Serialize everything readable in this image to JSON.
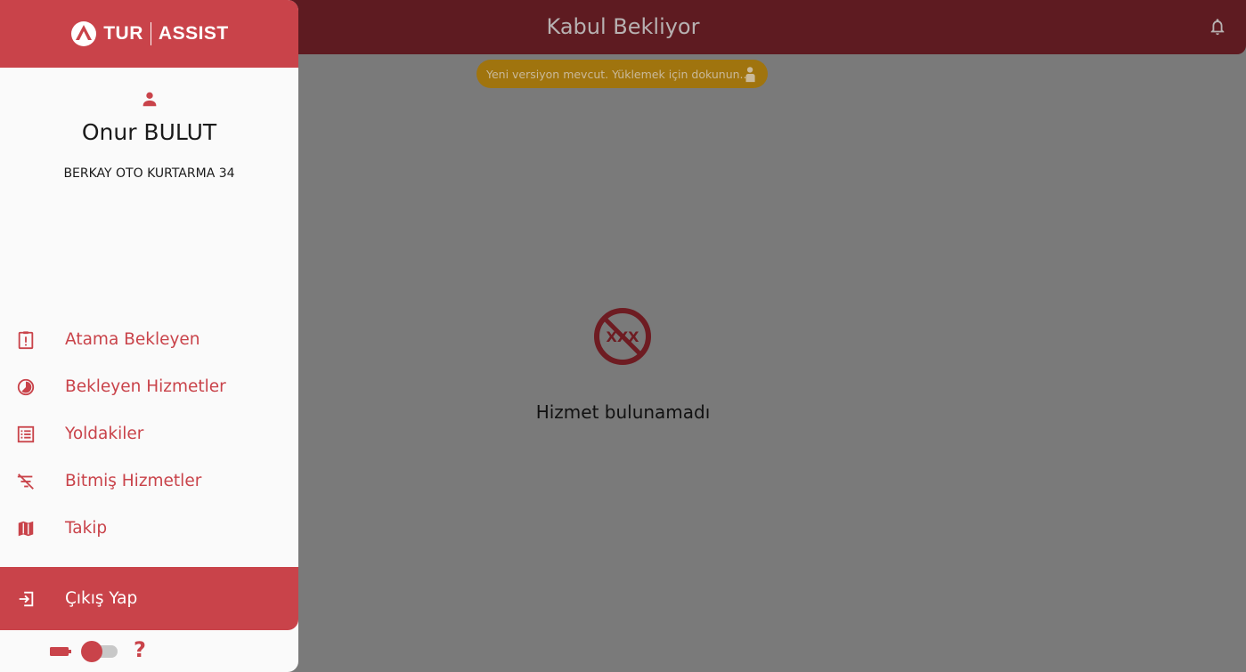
{
  "header": {
    "title": "Kabul Bekliyor",
    "notifications_icon": "bell-icon"
  },
  "update_banner": {
    "text": "Yeni versiyon mevcut. Yüklemek için dokunun...",
    "icon": "hand-tap-icon"
  },
  "empty_state": {
    "icon": "no-service-icon",
    "icon_text": "XXX",
    "message": "Hizmet bulunamadı"
  },
  "drawer": {
    "logo": {
      "left": "TUR",
      "right": "ASSIST"
    },
    "user": {
      "name": "Onur BULUT",
      "company": "BERKAY OTO KURTARMA 34",
      "icon": "person-icon"
    },
    "menu": [
      {
        "label": "Atama Bekleyen",
        "icon": "clipboard-alert-icon"
      },
      {
        "label": "Bekleyen Hizmetler",
        "icon": "progress-circle-icon"
      },
      {
        "label": "Yoldakiler",
        "icon": "list-icon"
      },
      {
        "label": "Bitmiş Hizmetler",
        "icon": "filter-off-icon"
      },
      {
        "label": "Takip",
        "icon": "map-icon"
      }
    ],
    "logout": {
      "label": "Çıkış Yap",
      "icon": "logout-icon"
    },
    "footer": {
      "battery_icon": "battery-icon",
      "toggle_on": true,
      "help_label": "?"
    }
  },
  "colors": {
    "accent": "#c9434a",
    "topbar": "#5e1b21",
    "overlay": "#7a7a7a",
    "banner": "#a0740e"
  }
}
